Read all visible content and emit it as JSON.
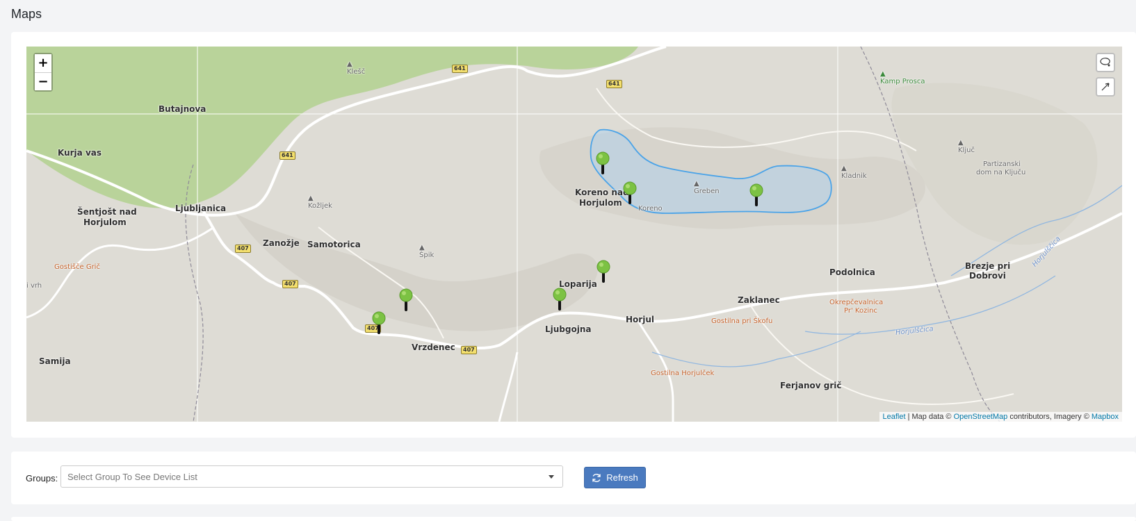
{
  "page": {
    "title": "Maps"
  },
  "map": {
    "zoom_in": "+",
    "zoom_out": "−",
    "controls": [
      "draw-polygon-icon",
      "draw-marker-icon"
    ],
    "towns": [
      "Butajnova",
      "Kurja vas",
      "Ljubljanica",
      "Šentjošt nad",
      "Horjulom",
      "Zanožje",
      "Samotorica",
      "Koreno nad",
      "Horjulom",
      "Loparija",
      "Ljubgojna",
      "Horjul",
      "Vrzdenec",
      "Samija",
      "Zaklanec",
      "Podolnica",
      "Brezje pri",
      "Dobrovi",
      "Ferjanov grič"
    ],
    "peaks": [
      "Klešč",
      "Kožljek",
      "Špik",
      "Koreno",
      "Greben",
      "Kladnik",
      "Ključ",
      "Partizanski",
      "dom na Ključu",
      "i vrh"
    ],
    "pois": [
      "Gostišče Grič",
      "Gostilna pri Škofu",
      "Okrepčevalnica",
      "Pr' Kozinc",
      "Gostilna Horjulček"
    ],
    "camp": "Kamp Prosca",
    "rivers": [
      "Horjulščica",
      "Horjulščica"
    ],
    "road_shields": [
      "641",
      "641",
      "641",
      "407",
      "407",
      "407",
      "407"
    ],
    "accent_colors": {
      "pin": "#7cc243",
      "zone": "#4aa3e8",
      "forest": "#b9d39a"
    },
    "attribution": {
      "leaflet": "Leaflet",
      "sep": " | Map data © ",
      "osm": "OpenStreetMap",
      "mid": " contributors, Imagery © ",
      "mapbox": "Mapbox"
    }
  },
  "groups": {
    "label": "Groups:",
    "placeholder": "Select Group To See Device List",
    "refresh_label": "Refresh"
  }
}
